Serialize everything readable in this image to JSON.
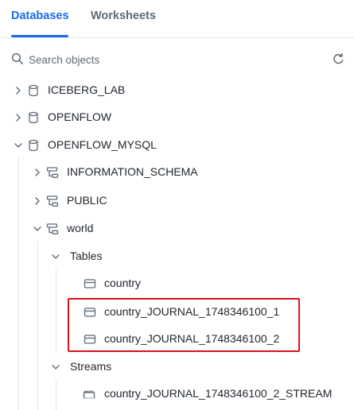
{
  "tabs": {
    "databases": "Databases",
    "worksheets": "Worksheets"
  },
  "search": {
    "placeholder": "Search objects",
    "value": ""
  },
  "tree": {
    "databases": [
      {
        "label": "ICEBERG_LAB",
        "expanded": false,
        "icon": "database-icon"
      },
      {
        "label": "OPENFLOW",
        "expanded": false,
        "icon": "database-icon"
      },
      {
        "label": "OPENFLOW_MYSQL",
        "expanded": true,
        "icon": "database-icon"
      }
    ],
    "schemas": [
      {
        "label": "INFORMATION_SCHEMA",
        "expanded": false,
        "icon": "schema-icon"
      },
      {
        "label": "PUBLIC",
        "expanded": false,
        "icon": "schema-icon"
      },
      {
        "label": "world",
        "expanded": true,
        "icon": "schema-icon"
      }
    ],
    "groups": {
      "tables": "Tables",
      "streams": "Streams"
    },
    "tables": [
      {
        "label": "country",
        "icon": "table-icon"
      },
      {
        "label": "country_JOURNAL_1748346100_1",
        "icon": "table-icon"
      },
      {
        "label": "country_JOURNAL_1748346100_2",
        "icon": "table-icon"
      }
    ],
    "streams": [
      {
        "label": "country_JOURNAL_1748346100_2_STREAM",
        "icon": "stream-icon"
      }
    ]
  },
  "colors": {
    "accent": "#1a6ce7",
    "highlight": "#d6131f",
    "text": "#1e252d",
    "muted": "#5d6a78"
  }
}
